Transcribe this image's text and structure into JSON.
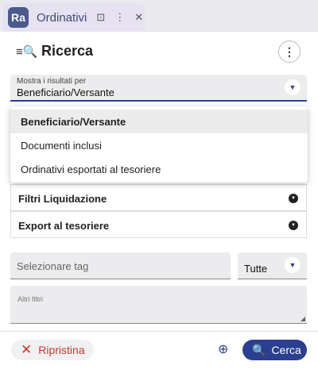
{
  "tab": {
    "icon_text": "Ra",
    "title": "Ordinativi",
    "bookmark_glyph": "⊡",
    "menu_glyph": "⋮",
    "close_glyph": "✕"
  },
  "header": {
    "filter_glyph": "≡🔍",
    "title": "Ricerca",
    "menu_glyph": "⋮"
  },
  "results_select": {
    "label": "Mostra i risultati per",
    "value": "Beneficiario/Versante",
    "arrow": "▼"
  },
  "dropdown": {
    "options": [
      "Beneficiario/Versante",
      "Documenti inclusi",
      "Ordinativi esportati al tesoriere"
    ],
    "selected_index": 0
  },
  "accordions": [
    {
      "label": "Filtri Liquidazione",
      "arrow": "▼"
    },
    {
      "label": "Export al tesoriere",
      "arrow": "▼"
    }
  ],
  "tag_select": {
    "placeholder": "Selezionare tag"
  },
  "tutte_select": {
    "value": "Tutte",
    "arrow": "▼"
  },
  "other_filters": {
    "placeholder": "Altri filtri",
    "resize_glyph": "◢"
  },
  "actions": {
    "reset_icon": "✕",
    "reset_label": "Ripristina",
    "zoom_icon": "⊕",
    "search_icon": "🔍",
    "search_label": "Cerca"
  },
  "colors": {
    "accent": "#2a3f91",
    "danger": "#c0392b",
    "tab_bg": "#e6e2f2",
    "field_bg": "#ececee"
  }
}
